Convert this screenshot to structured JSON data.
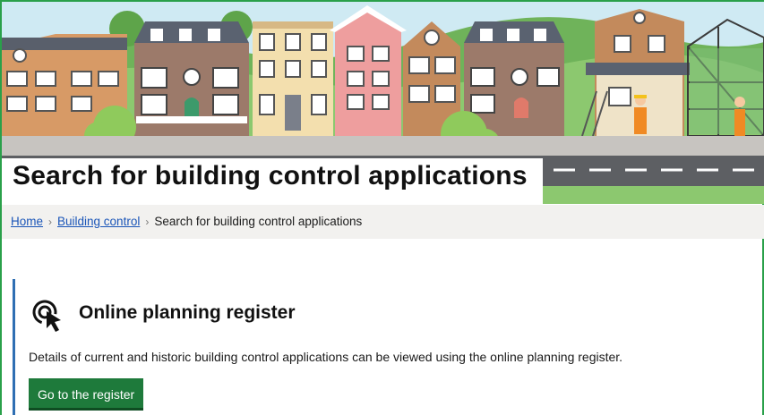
{
  "page": {
    "title": "Search for building control applications"
  },
  "breadcrumb": {
    "items": [
      {
        "label": "Home",
        "link": true
      },
      {
        "label": "Building control",
        "link": true
      },
      {
        "label": "Search for building control applications",
        "link": false
      }
    ],
    "separator": "›"
  },
  "callout": {
    "icon": "cursor-click-icon",
    "title": "Online planning register",
    "text": "Details of current and historic building control applications can be viewed using the online planning register.",
    "button_label": "Go to the register"
  },
  "colors": {
    "accent_green": "#1e7a3b",
    "link_blue": "#1a55b8",
    "callout_border": "#2f6fb3",
    "breadcrumb_bg": "#f2f1ef"
  }
}
